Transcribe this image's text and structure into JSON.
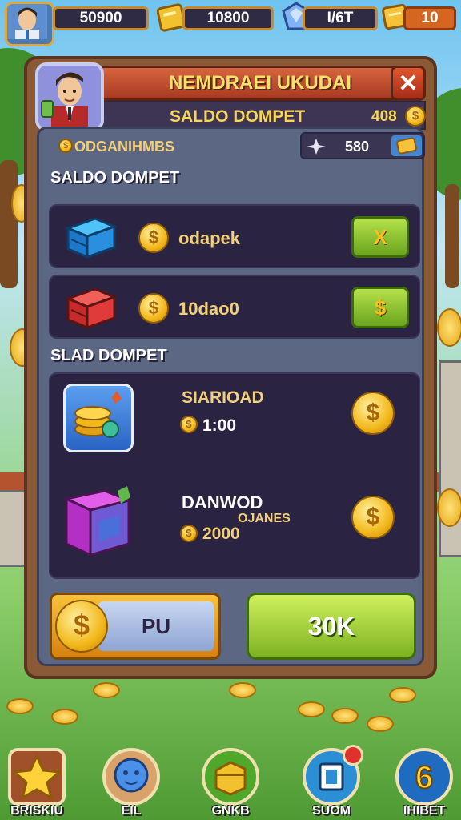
{
  "hud": {
    "gold": "50900",
    "gems": "10800",
    "energy": "I/6T",
    "tickets": "10"
  },
  "panel": {
    "title": "NEMDRAEI UKUDAI",
    "subtitle": "SALDO DOMPET",
    "subtitle_value": "408",
    "info_label": "ODGANIHMBS",
    "info_value": "580",
    "section1_label": "SALDO DOMPET",
    "row1_text": "odapek",
    "row1_button": "X",
    "row2_text": "10dao0",
    "row2_button": "$",
    "section2_label": "SLAD DOMPET",
    "reward1_title": "SIARIOAD",
    "reward1_amount": "1:00",
    "reward2_title": "DANWOD",
    "reward2_subtitle": "OJANES",
    "reward2_amount": "2000",
    "left_button": "PU",
    "right_button": "30K",
    "colors": {
      "title_text": "#fce06d",
      "panel_bg": "#8a5a36",
      "button_green": "#8cc42c"
    }
  },
  "nav": [
    {
      "label": "BRISKIU",
      "icon": "star-icon",
      "color": "#a0512a"
    },
    {
      "label": "EIL",
      "icon": "globe-icon",
      "color": "#3a7fd4"
    },
    {
      "label": "GNKB",
      "icon": "treasure-icon",
      "color": "#4fa82a"
    },
    {
      "label": "SUOM",
      "icon": "cube-icon",
      "color": "#2b8fd6"
    },
    {
      "label": "IHIBET",
      "icon": "number-six-icon",
      "color": "#1f6bbf"
    }
  ]
}
